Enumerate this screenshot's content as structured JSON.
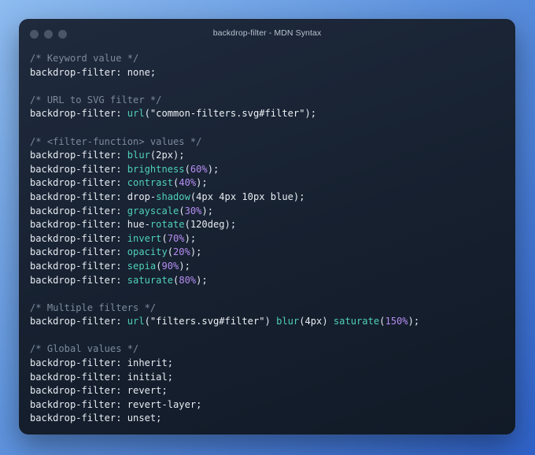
{
  "window": {
    "title": "backdrop-filter - MDN Syntax"
  },
  "code": {
    "lines": [
      {
        "segs": [
          [
            "cm",
            "/* Keyword value */"
          ]
        ]
      },
      {
        "segs": [
          [
            "pl",
            "backdrop-filter: none;"
          ]
        ]
      },
      {
        "segs": []
      },
      {
        "segs": [
          [
            "cm",
            "/* URL to SVG filter */"
          ]
        ]
      },
      {
        "segs": [
          [
            "pl",
            "backdrop-filter: "
          ],
          [
            "fn",
            "url"
          ],
          [
            "pl",
            "("
          ],
          [
            "st",
            "\"common-filters.svg#filter\""
          ],
          [
            "pl",
            ");"
          ]
        ]
      },
      {
        "segs": []
      },
      {
        "segs": [
          [
            "cm",
            "/* <filter-function> values */"
          ]
        ]
      },
      {
        "segs": [
          [
            "pl",
            "backdrop-filter: "
          ],
          [
            "fn",
            "blur"
          ],
          [
            "pl",
            "(2px);"
          ]
        ]
      },
      {
        "segs": [
          [
            "pl",
            "backdrop-filter: "
          ],
          [
            "fn",
            "brightness"
          ],
          [
            "pl",
            "("
          ],
          [
            "pc",
            "60%"
          ],
          [
            "pl",
            ");"
          ]
        ]
      },
      {
        "segs": [
          [
            "pl",
            "backdrop-filter: "
          ],
          [
            "fn",
            "contrast"
          ],
          [
            "pl",
            "("
          ],
          [
            "pc",
            "40%"
          ],
          [
            "pl",
            ");"
          ]
        ]
      },
      {
        "segs": [
          [
            "pl",
            "backdrop-filter: drop-"
          ],
          [
            "fn",
            "shadow"
          ],
          [
            "pl",
            "(4px 4px 10px blue);"
          ]
        ]
      },
      {
        "segs": [
          [
            "pl",
            "backdrop-filter: "
          ],
          [
            "fn",
            "grayscale"
          ],
          [
            "pl",
            "("
          ],
          [
            "pc",
            "30%"
          ],
          [
            "pl",
            ");"
          ]
        ]
      },
      {
        "segs": [
          [
            "pl",
            "backdrop-filter: hue-"
          ],
          [
            "fn",
            "rotate"
          ],
          [
            "pl",
            "(120deg);"
          ]
        ]
      },
      {
        "segs": [
          [
            "pl",
            "backdrop-filter: "
          ],
          [
            "fn",
            "invert"
          ],
          [
            "pl",
            "("
          ],
          [
            "pc",
            "70%"
          ],
          [
            "pl",
            ");"
          ]
        ]
      },
      {
        "segs": [
          [
            "pl",
            "backdrop-filter: "
          ],
          [
            "fn",
            "opacity"
          ],
          [
            "pl",
            "("
          ],
          [
            "pc",
            "20%"
          ],
          [
            "pl",
            ");"
          ]
        ]
      },
      {
        "segs": [
          [
            "pl",
            "backdrop-filter: "
          ],
          [
            "fn",
            "sepia"
          ],
          [
            "pl",
            "("
          ],
          [
            "pc",
            "90%"
          ],
          [
            "pl",
            ");"
          ]
        ]
      },
      {
        "segs": [
          [
            "pl",
            "backdrop-filter: "
          ],
          [
            "fn",
            "saturate"
          ],
          [
            "pl",
            "("
          ],
          [
            "pc",
            "80%"
          ],
          [
            "pl",
            ");"
          ]
        ]
      },
      {
        "segs": []
      },
      {
        "segs": [
          [
            "cm",
            "/* Multiple filters */"
          ]
        ]
      },
      {
        "segs": [
          [
            "pl",
            "backdrop-filter: "
          ],
          [
            "fn",
            "url"
          ],
          [
            "pl",
            "("
          ],
          [
            "st",
            "\"filters.svg#filter\""
          ],
          [
            "pl",
            ") "
          ],
          [
            "fn",
            "blur"
          ],
          [
            "pl",
            "(4px) "
          ],
          [
            "fn",
            "saturate"
          ],
          [
            "pl",
            "("
          ],
          [
            "pc",
            "150%"
          ],
          [
            "pl",
            ");"
          ]
        ]
      },
      {
        "segs": []
      },
      {
        "segs": [
          [
            "cm",
            "/* Global values */"
          ]
        ]
      },
      {
        "segs": [
          [
            "pl",
            "backdrop-filter: inherit;"
          ]
        ]
      },
      {
        "segs": [
          [
            "pl",
            "backdrop-filter: initial;"
          ]
        ]
      },
      {
        "segs": [
          [
            "pl",
            "backdrop-filter: revert;"
          ]
        ]
      },
      {
        "segs": [
          [
            "pl",
            "backdrop-filter: revert-layer;"
          ]
        ]
      },
      {
        "segs": [
          [
            "pl",
            "backdrop-filter: unset;"
          ]
        ]
      }
    ]
  }
}
